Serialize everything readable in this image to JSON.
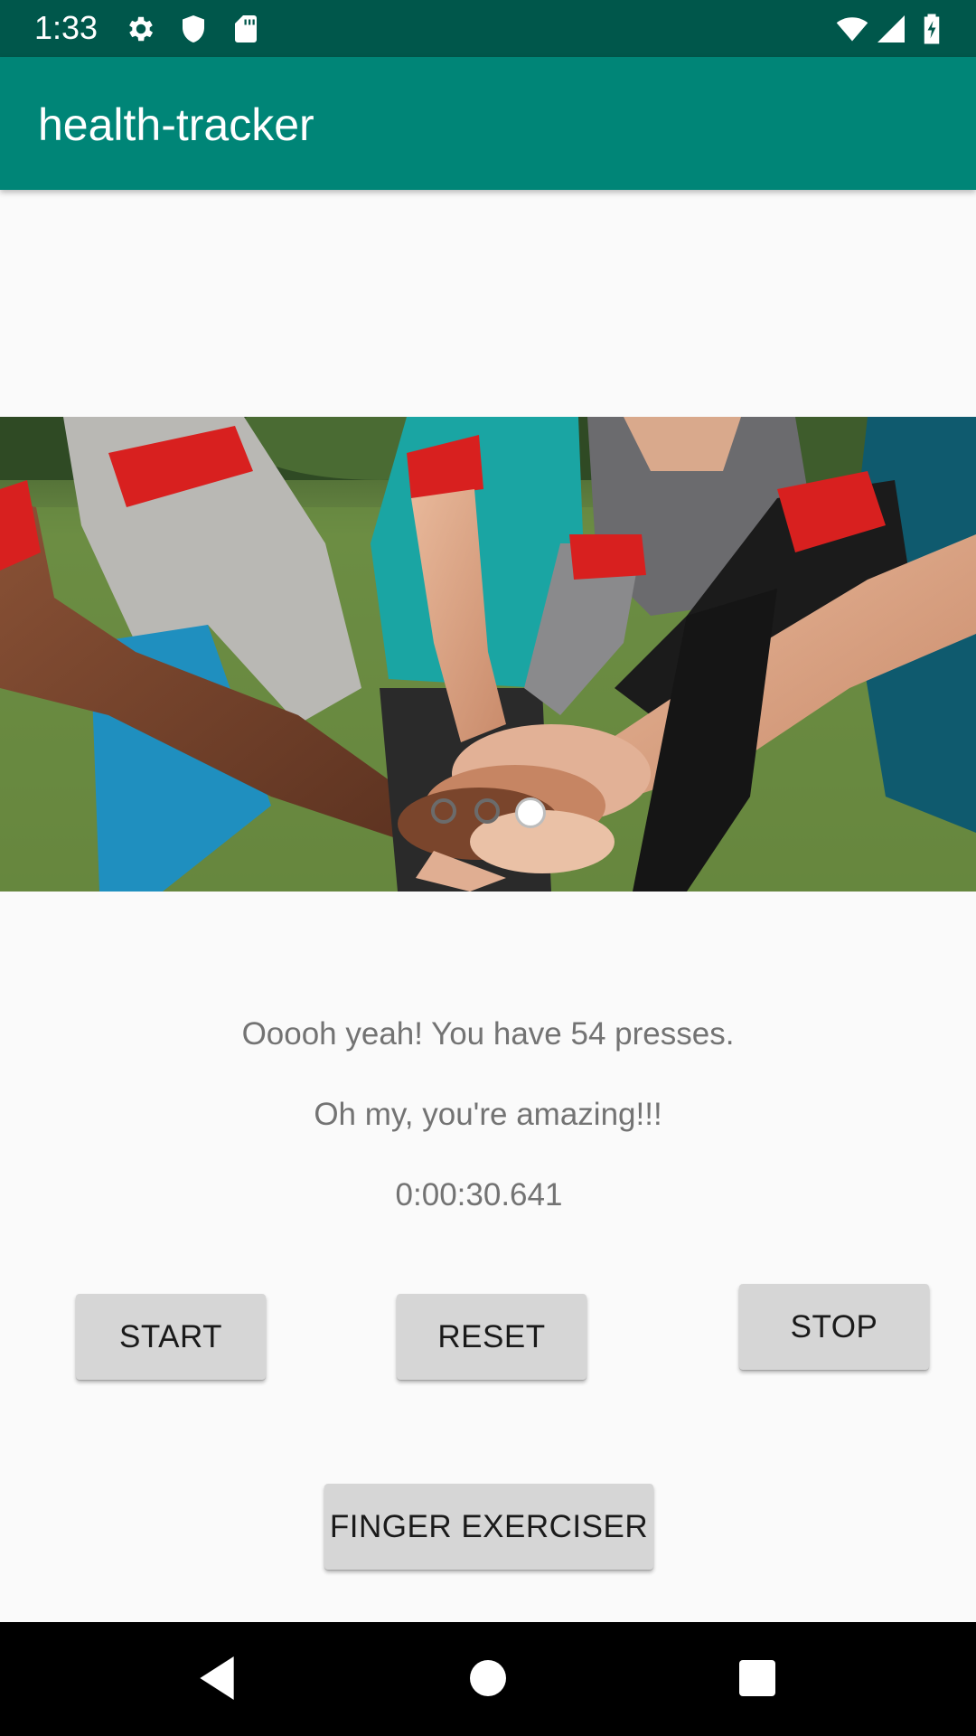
{
  "status_bar": {
    "time": "1:33",
    "icons": [
      "gear-icon",
      "shield-icon",
      "sd-card-icon",
      "wifi-icon",
      "signal-icon",
      "battery-icon"
    ]
  },
  "app_bar": {
    "title": "health-tracker"
  },
  "carousel": {
    "image": "people-stacking-hands-photo",
    "page_count": 3,
    "active_page": 3
  },
  "messages": {
    "presses": "Ooooh yeah! You have 54 presses.",
    "praise": "Oh my, you're amazing!!!",
    "timer": "0:00:30.641"
  },
  "buttons": {
    "start": "START",
    "reset": "RESET",
    "stop": "STOP",
    "finger_exerciser": "FINGER EXERCISER"
  },
  "nav_bar": {
    "icons": [
      "back-icon",
      "home-icon",
      "recents-icon"
    ]
  },
  "colors": {
    "status_bar": "#00574b",
    "app_bar": "#008577",
    "button": "#d6d6d6",
    "message_text": "#737373"
  }
}
